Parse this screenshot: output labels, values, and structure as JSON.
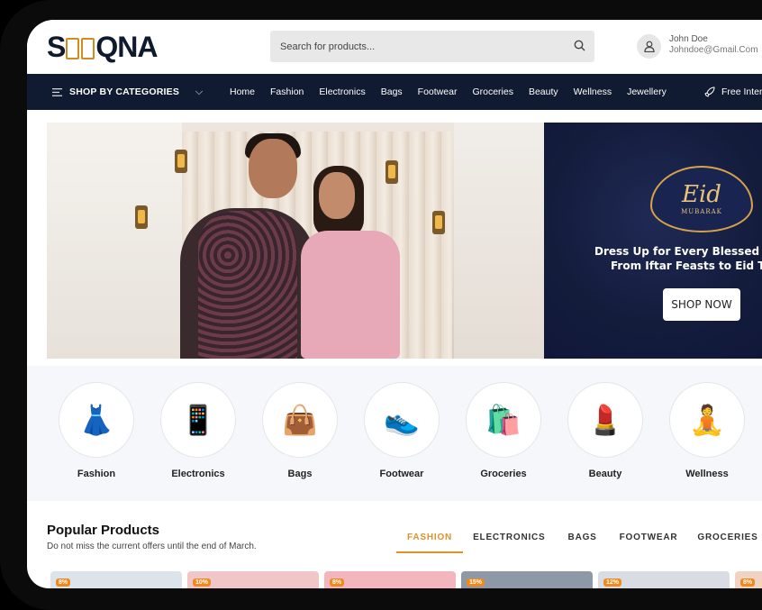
{
  "header": {
    "logo": {
      "prefix": "S",
      "suffix": "QNA"
    },
    "search": {
      "placeholder": "Search for products..."
    },
    "user": {
      "name": "John Doe",
      "email": "Johndoe@Gmail.Com"
    }
  },
  "nav": {
    "categories_label": "SHOP BY CATEGORIES",
    "links": [
      "Home",
      "Fashion",
      "Electronics",
      "Bags",
      "Footwear",
      "Groceries",
      "Beauty",
      "Wellness",
      "Jewellery"
    ],
    "free_label": "Free Inter"
  },
  "banner": {
    "eid_word": "Eid",
    "eid_sub": "MUBARAK",
    "line1": "Dress Up for Every Blessed M",
    "line2": "From Iftar Feasts to Eid Tr",
    "cta": "SHOP NOW"
  },
  "categories": [
    {
      "label": "Fashion",
      "icon": "fashion-icon"
    },
    {
      "label": "Electronics",
      "icon": "electronics-icon"
    },
    {
      "label": "Bags",
      "icon": "bags-icon"
    },
    {
      "label": "Footwear",
      "icon": "footwear-icon"
    },
    {
      "label": "Groceries",
      "icon": "groceries-icon"
    },
    {
      "label": "Beauty",
      "icon": "beauty-icon"
    },
    {
      "label": "Wellness",
      "icon": "wellness-icon"
    }
  ],
  "popular": {
    "title": "Popular Products",
    "subtitle": "Do not miss the current offers until the end of March.",
    "tabs": [
      "FASHION",
      "ELECTRONICS",
      "BAGS",
      "FOOTWEAR",
      "GROCERIES"
    ],
    "active_tab": "FASHION"
  },
  "products": [
    {
      "discount": "8%"
    },
    {
      "discount": "10%"
    },
    {
      "discount": "8%"
    },
    {
      "discount": "15%"
    },
    {
      "discount": "12%"
    },
    {
      "discount": "8%"
    }
  ],
  "colors": {
    "nav_bg": "#101a30",
    "accent": "#e0922a",
    "promo_bg": "#141c3c"
  }
}
